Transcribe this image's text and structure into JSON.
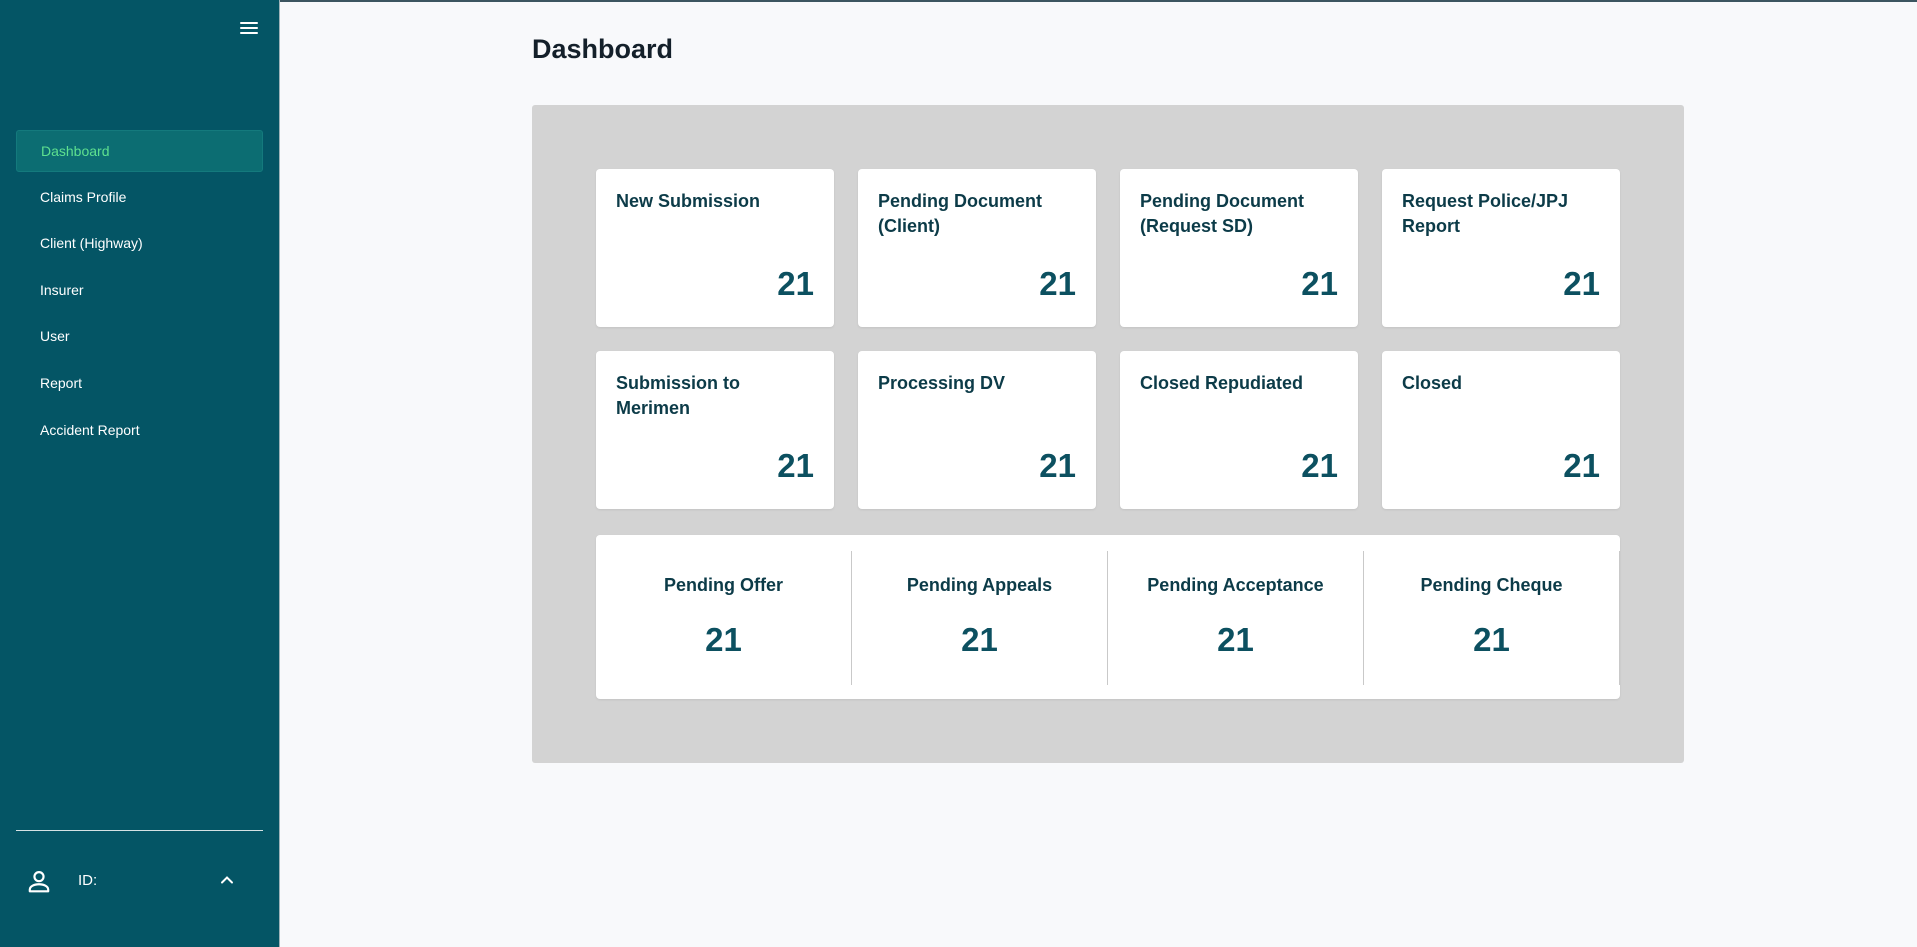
{
  "sidebar": {
    "items": [
      {
        "label": "Dashboard",
        "active": true
      },
      {
        "label": "Claims Profile"
      },
      {
        "label": "Client (Highway)"
      },
      {
        "label": "Insurer"
      },
      {
        "label": "User"
      },
      {
        "label": "Report"
      },
      {
        "label": "Accident Report"
      }
    ],
    "user": {
      "id_label": "ID:",
      "icon": "user-icon",
      "chevron": "chevron-up-icon"
    },
    "menu_icon": "hamburger-menu-icon"
  },
  "page": {
    "title": "Dashboard"
  },
  "cards": [
    {
      "label": "New Submission",
      "count": "21"
    },
    {
      "label": "Pending Document (Client)",
      "count": "21"
    },
    {
      "label": "Pending Document (Request SD)",
      "count": "21"
    },
    {
      "label": "Request Police/JPJ Report",
      "count": "21"
    },
    {
      "label": "Submission to Merimen",
      "count": "21"
    },
    {
      "label": "Processing DV",
      "count": "21"
    },
    {
      "label": "Closed Repudiated",
      "count": "21"
    },
    {
      "label": "Closed",
      "count": "21"
    }
  ],
  "pending": [
    {
      "label": "Pending Offer",
      "count": "21"
    },
    {
      "label": "Pending Appeals",
      "count": "21"
    },
    {
      "label": "Pending Acceptance",
      "count": "21"
    },
    {
      "label": "Pending Cheque",
      "count": "21"
    }
  ],
  "colors": {
    "sidebar_bg": "#045565",
    "active_text": "#5ee08f",
    "panel_bg": "#d3d3d3",
    "count_text": "#0c5060"
  }
}
